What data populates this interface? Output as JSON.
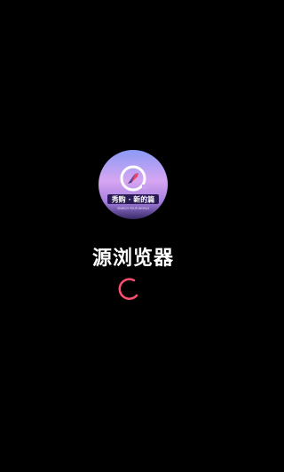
{
  "splash": {
    "logo": {
      "icon": "compass-icon",
      "badge_text": "秀购 · 新的篇",
      "tagline": "SEARCH YOUR WORLD",
      "gradient_top": "#7b8cf0",
      "gradient_mid": "#c9a0f0",
      "gradient_bottom": "#3a2a6a",
      "badge_color": "#2a1a55",
      "compass_north": "#e8456b",
      "compass_south": "#3a3f8f"
    },
    "app_name": "源浏览器",
    "loading_indicator": "loading-spinner",
    "accent_color": "#ff4f6e",
    "background_color": "#000000"
  }
}
